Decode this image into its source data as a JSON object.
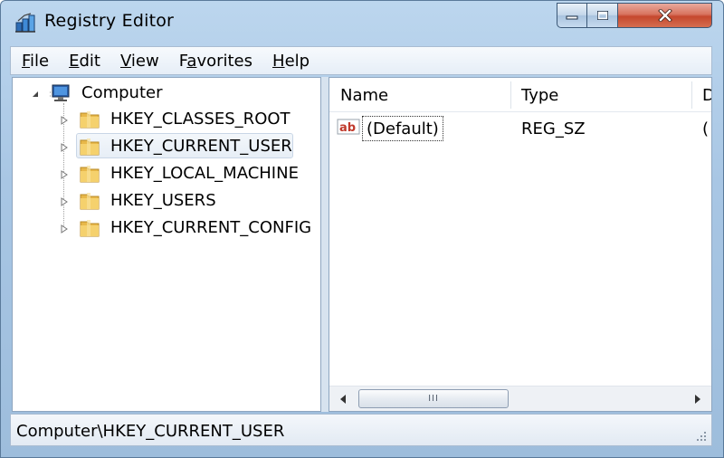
{
  "window": {
    "title": "Registry Editor",
    "icon": "registry-editor-icon",
    "caption_buttons": [
      "minimize",
      "maximize",
      "close"
    ]
  },
  "menu": [
    {
      "mnemonic": "F",
      "rest": "ile"
    },
    {
      "mnemonic": "E",
      "rest": "dit"
    },
    {
      "mnemonic": "V",
      "rest": "iew"
    },
    {
      "mnemonic": "",
      "rest": "Favorites",
      "pre": "F",
      "mid": "a",
      "post": "vorites"
    },
    {
      "mnemonic": "H",
      "rest": "elp"
    }
  ],
  "tree": {
    "root": {
      "label": "Computer",
      "icon": "computer-icon",
      "expanded": true
    },
    "keys": [
      {
        "label": "HKEY_CLASSES_ROOT",
        "icon": "folder-icon",
        "selected": false
      },
      {
        "label": "HKEY_CURRENT_USER",
        "icon": "folder-icon",
        "selected": true
      },
      {
        "label": "HKEY_LOCAL_MACHINE",
        "icon": "folder-icon",
        "selected": false
      },
      {
        "label": "HKEY_USERS",
        "icon": "folder-icon",
        "selected": false
      },
      {
        "label": "HKEY_CURRENT_CONFIG",
        "icon": "folder-icon",
        "selected": false
      }
    ]
  },
  "list": {
    "columns": [
      "Name",
      "Type",
      "D"
    ],
    "rows": [
      {
        "name": "(Default)",
        "type": "REG_SZ",
        "data": "(",
        "icon": "string-value-icon"
      }
    ],
    "scroll_thumb_grip": "III"
  },
  "status": {
    "path": "Computer\\HKEY_CURRENT_USER"
  },
  "colors": {
    "title_bar": "#a8c6e4",
    "close_button": "#c5482e",
    "folder": "#f2c75c"
  }
}
